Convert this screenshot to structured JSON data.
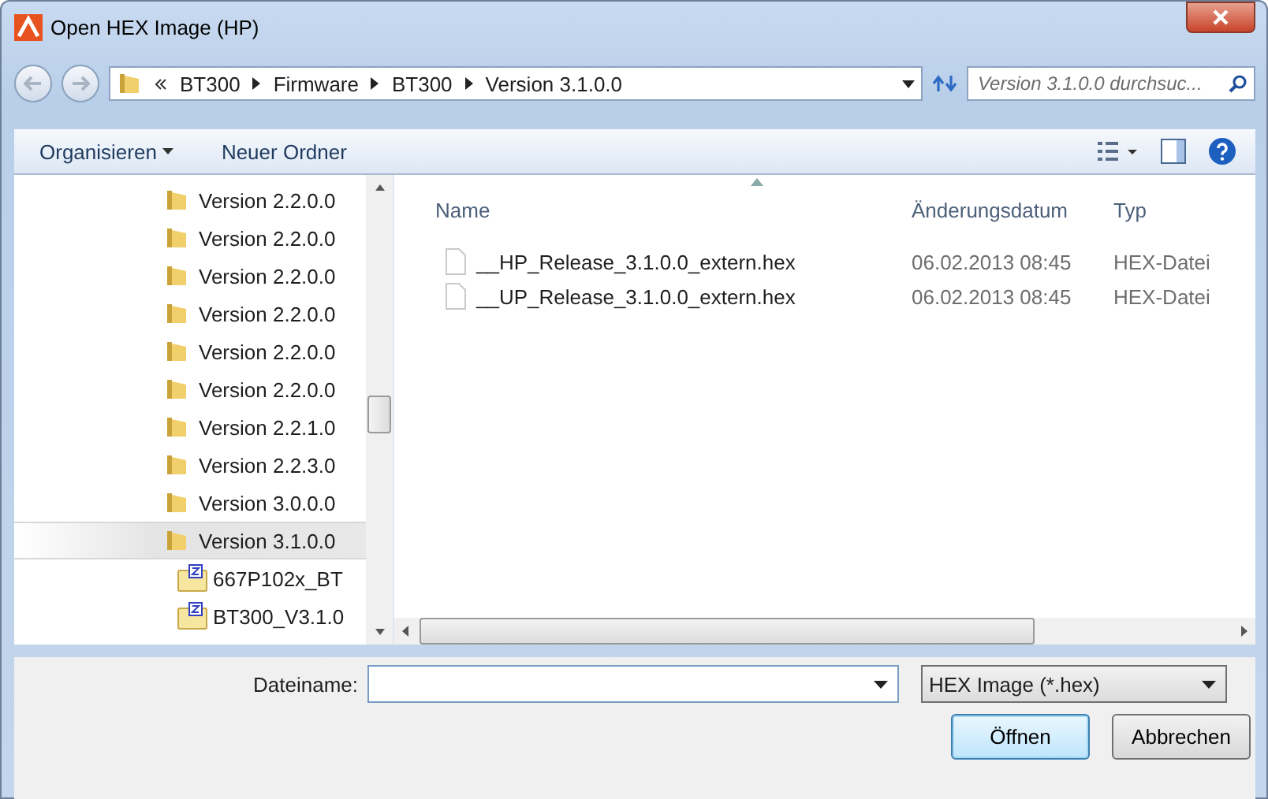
{
  "window": {
    "title": "Open HEX Image (HP)"
  },
  "address_bar": {
    "path": [
      {
        "label": "BT300"
      },
      {
        "label": "Firmware"
      },
      {
        "label": "BT300"
      },
      {
        "label": "Version 3.1.0.0"
      }
    ]
  },
  "search": {
    "placeholder": "Version 3.1.0.0 durchsuc..."
  },
  "toolbar": {
    "buttons": [
      {
        "label": "Organisieren",
        "kind": "menu"
      },
      {
        "label": "Neuer Ordner",
        "kind": "plain"
      }
    ]
  },
  "tree": {
    "items": [
      {
        "label": "Version 2.2.0.0",
        "kind": "folder",
        "selected": false
      },
      {
        "label": "Version 2.2.0.0",
        "kind": "folder",
        "selected": false
      },
      {
        "label": "Version 2.2.0.0",
        "kind": "folder",
        "selected": false
      },
      {
        "label": "Version 2.2.0.0",
        "kind": "folder",
        "selected": false
      },
      {
        "label": "Version 2.2.0.0",
        "kind": "folder",
        "selected": false
      },
      {
        "label": "Version 2.2.0.0",
        "kind": "folder",
        "selected": false
      },
      {
        "label": "Version 2.2.1.0",
        "kind": "folder",
        "selected": false
      },
      {
        "label": "Version 2.2.3.0",
        "kind": "folder",
        "selected": false
      },
      {
        "label": "Version 3.0.0.0",
        "kind": "folder",
        "selected": false
      },
      {
        "label": "Version 3.1.0.0",
        "kind": "folder",
        "selected": true,
        "children": [
          {
            "label": "667P102x_BT",
            "kind": "archive",
            "selected": false
          },
          {
            "label": "BT300_V3.1.0",
            "kind": "archive",
            "selected": false
          }
        ]
      }
    ]
  },
  "file_list": {
    "columns": [
      "Name",
      "Änderungsdatum",
      "Typ"
    ],
    "rows": [
      {
        "name": "__HP_Release_3.1.0.0_extern.hex",
        "date": "06.02.2013 08:45",
        "type": "HEX-Datei"
      },
      {
        "name": "__UP_Release_3.1.0.0_extern.hex",
        "date": "06.02.2013 08:45",
        "type": "HEX-Datei"
      }
    ]
  },
  "filename": {
    "label": "Dateiname:"
  },
  "filter": {
    "value": "HEX Image (*.hex)"
  },
  "buttons": [
    {
      "label": "Öffnen",
      "kind": "default"
    },
    {
      "label": "Abbrechen",
      "kind": "normal"
    }
  ]
}
